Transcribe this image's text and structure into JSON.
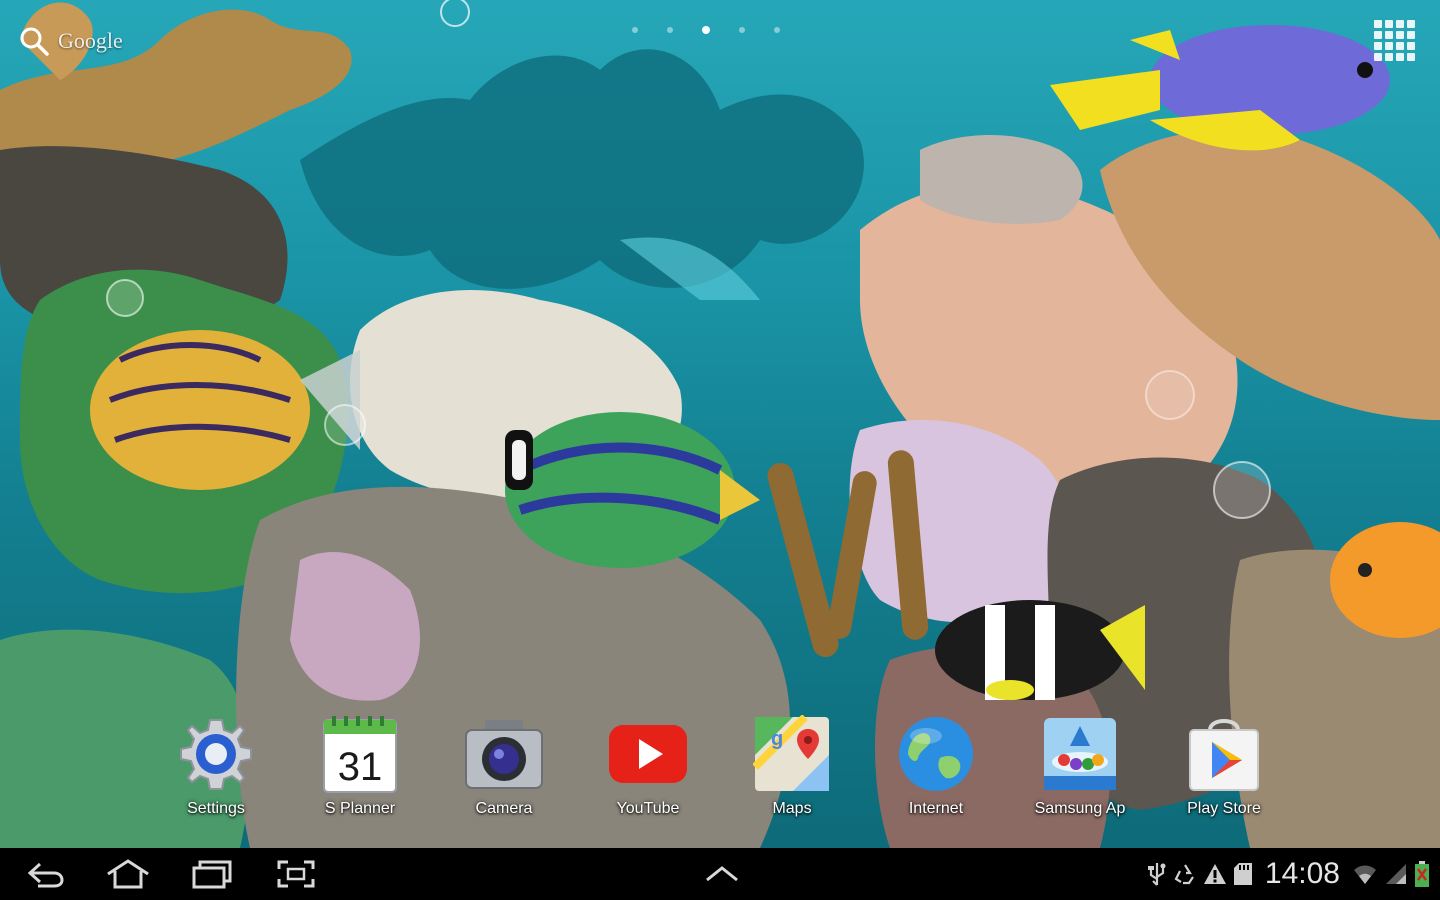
{
  "search": {
    "label": "Google",
    "icon": "search-icon"
  },
  "pager": {
    "pages": 5,
    "active_index": 2
  },
  "apps_button": {
    "icon": "app-grid-icon"
  },
  "dock": {
    "apps": [
      {
        "label": "Settings",
        "icon": "settings-gear-icon"
      },
      {
        "label": "S Planner",
        "icon": "calendar-icon",
        "calendar_day": "31"
      },
      {
        "label": "Camera",
        "icon": "camera-icon"
      },
      {
        "label": "YouTube",
        "icon": "youtube-icon"
      },
      {
        "label": "Maps",
        "icon": "maps-icon"
      },
      {
        "label": "Internet",
        "icon": "globe-icon"
      },
      {
        "label": "Samsung Ap",
        "icon": "samsung-apps-icon"
      },
      {
        "label": "Play Store",
        "icon": "play-store-icon"
      }
    ]
  },
  "system_bar": {
    "buttons": [
      "back-icon",
      "home-icon",
      "recent-apps-icon",
      "screenshot-icon",
      "expand-up-icon"
    ],
    "status_icons": [
      "usb-icon",
      "recycle-icon",
      "warning-icon",
      "sd-card-icon",
      "wifi-icon",
      "signal-icon",
      "battery-icon"
    ],
    "time": "14:08"
  },
  "colors": {
    "water": "#1993a5",
    "system_bar": "#000000",
    "youtube_red": "#e62117",
    "battery_green": "#4caf50"
  }
}
